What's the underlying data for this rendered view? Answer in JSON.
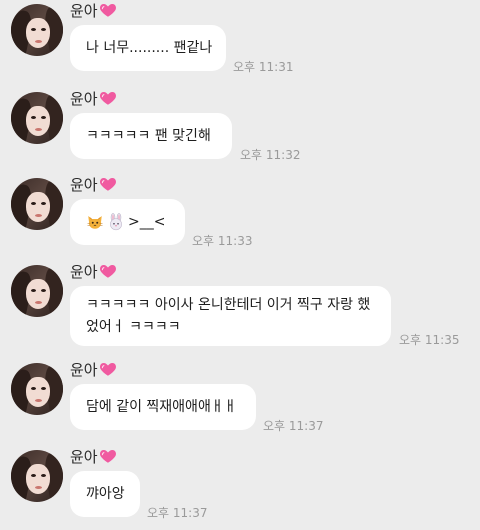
{
  "chat": {
    "messages": [
      {
        "sender": "윤아",
        "text": "나 너무......... 팬같나",
        "time": "오후 11:31"
      },
      {
        "sender": "윤아",
        "text": "ㅋㅋㅋㅋㅋ 팬 맞긴해",
        "time": "오후 11:32"
      },
      {
        "sender": "윤아",
        "emojis": [
          "cat-face-icon",
          "rabbit-face-icon"
        ],
        "text": ">__<",
        "time": "오후 11:33"
      },
      {
        "sender": "윤아",
        "text_line1": "ㅋㅋㅋㅋㅋ 아이사 온니한테더 이거 찍구 자랑 했",
        "text_line2": "었어ㅓ ㅋㅋㅋㅋ",
        "time": "오후 11:35"
      },
      {
        "sender": "윤아",
        "text": "담에 같이 찍재애애애ㅐㅐ",
        "time": "오후 11:37"
      },
      {
        "sender": "윤아",
        "text": "꺄아앙",
        "time": "오후 11:37"
      }
    ]
  },
  "colors": {
    "background": "#ececec",
    "bubble": "#ffffff",
    "time_text": "#9a9a9a",
    "heart": "#f05aa0"
  }
}
